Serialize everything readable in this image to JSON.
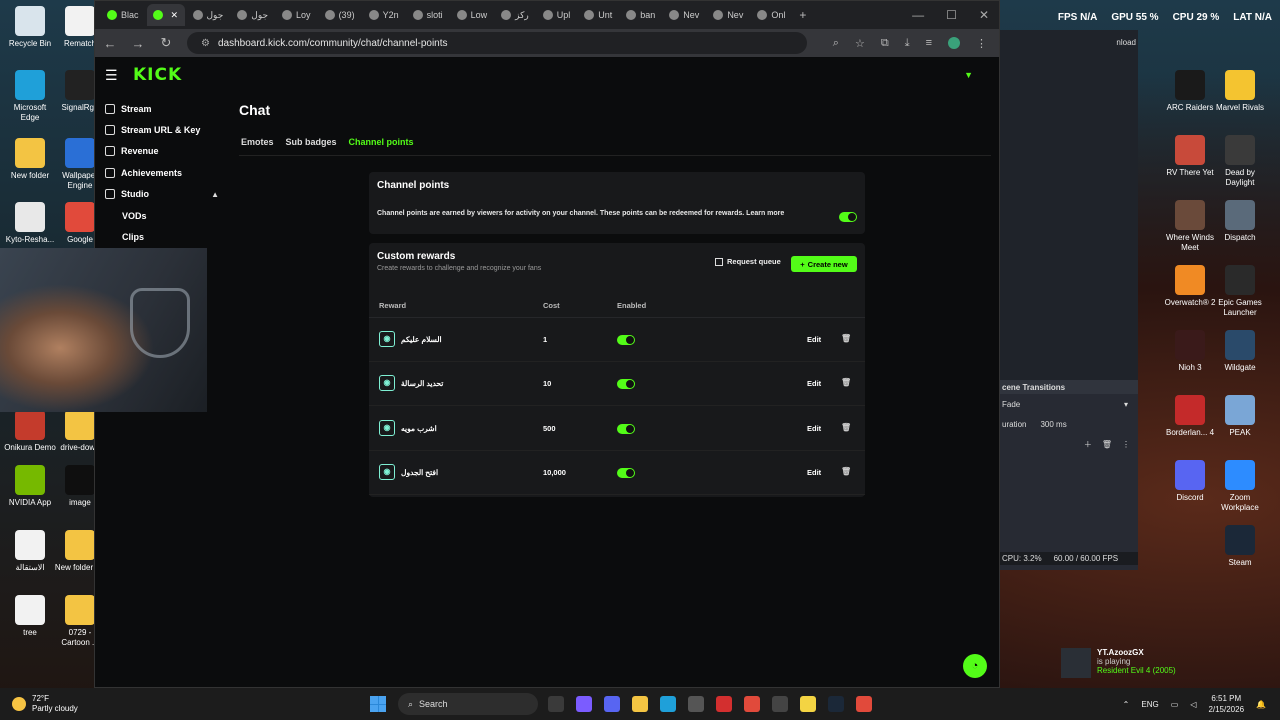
{
  "hud": {
    "fps_label": "FPS",
    "fps": "N/A",
    "gpu_label": "GPU",
    "gpu": "55 %",
    "cpu_label": "CPU",
    "cpu": "29 %",
    "lat_label": "LAT",
    "lat": "N/A"
  },
  "desktop_left": [
    {
      "label": "Recycle Bin",
      "color": "#d9e4ec"
    },
    {
      "label": "Rematch",
      "color": "#f2f2f2"
    },
    {
      "label": "Microsoft Edge",
      "color": "#1fa0d9"
    },
    {
      "label": "SignalRgb",
      "color": "#222222"
    },
    {
      "label": "New folder",
      "color": "#f3c443"
    },
    {
      "label": "Wallpaper Engine",
      "color": "#2a6fd6"
    },
    {
      "label": "Kyto-Resha...",
      "color": "#e8e8e8"
    },
    {
      "label": "Google",
      "color": "#e14a3b"
    },
    {
      "label": "Onikura Demo",
      "color": "#c43b2c"
    },
    {
      "label": "drive-down",
      "color": "#f3c443"
    },
    {
      "label": "NVIDIA App",
      "color": "#76b900"
    },
    {
      "label": "image",
      "color": "#0f0f0f"
    },
    {
      "label": "الاستقالة",
      "color": "#f2f2f2"
    },
    {
      "label": "New folder (3)",
      "color": "#f3c443"
    },
    {
      "label": "tree",
      "color": "#f2f2f2"
    },
    {
      "label": "0729 - Cartoon ...",
      "color": "#f3c443"
    }
  ],
  "desktop_right": [
    {
      "label": "ARC Raiders",
      "color": "#1a1a1a"
    },
    {
      "label": "Marvel Rivals",
      "color": "#f4c430"
    },
    {
      "label": "RV There Yet",
      "color": "#c84a3a"
    },
    {
      "label": "Dead by Daylight",
      "color": "#3a3a3a"
    },
    {
      "label": "Where Winds Meet",
      "color": "#6a4a3a"
    },
    {
      "label": "Dispatch",
      "color": "#5a6a7a"
    },
    {
      "label": "Overwatch® 2",
      "color": "#f08a24"
    },
    {
      "label": "Epic Games Launcher",
      "color": "#2a2a2a"
    },
    {
      "label": "Nioh 3",
      "color": "#3a1a1a"
    },
    {
      "label": "Wildgate",
      "color": "#2a4a6a"
    },
    {
      "label": "Borderlan... 4",
      "color": "#c42a2a"
    },
    {
      "label": "PEAK",
      "color": "#7aa6d6"
    },
    {
      "label": "Discord",
      "color": "#5865f2"
    },
    {
      "label": "Zoom Workplace",
      "color": "#2d8cff"
    },
    {
      "label": "Steam",
      "color": "#1b2838"
    }
  ],
  "browser": {
    "tabs": [
      "Blac",
      "",
      "جول",
      "جول",
      "Loy",
      "(39)",
      "Y2n",
      "sloti",
      "Low",
      "ركز",
      "Upl",
      "Unt",
      "ban",
      "Nev",
      "Nev",
      "Onl"
    ],
    "new_tab": "+",
    "url": "dashboard.kick.com/community/chat/channel-points"
  },
  "app": {
    "logo": "KICK",
    "sidebar": [
      {
        "label": "Stream"
      },
      {
        "label": "Stream URL & Key"
      },
      {
        "label": "Revenue"
      },
      {
        "label": "Achievements"
      },
      {
        "label": "Studio"
      }
    ],
    "studio_sub": [
      "VODs",
      "Clips"
    ],
    "page_title": "Chat",
    "tabs": [
      "Emotes",
      "Sub badges",
      "Channel points"
    ],
    "channel_points": {
      "title": "Channel points",
      "description": "Channel points are earned by viewers for activity on your channel. These points can be redeemed for rewards. Learn more",
      "enabled": true
    },
    "custom_rewards": {
      "title": "Custom rewards",
      "subtitle": "Create rewards to challenge and recognize your fans",
      "request_queue": "Request queue",
      "create_new": "Create new",
      "columns": {
        "reward": "Reward",
        "cost": "Cost",
        "enabled": "Enabled"
      },
      "edit_label": "Edit",
      "rows": [
        {
          "name": "السلام عليكم",
          "cost": "1"
        },
        {
          "name": "تحديد الرسالة",
          "cost": "10"
        },
        {
          "name": "اشرب مويه",
          "cost": "500"
        },
        {
          "name": "افتح الجدول",
          "cost": "10,000"
        }
      ]
    }
  },
  "obs": {
    "scene_transitions": "cene Transitions",
    "transition": "Fade",
    "duration_label": "uration",
    "duration": "300 ms",
    "cpu": "CPU: 3.2%",
    "fps": "60.00 / 60.00 FPS",
    "download": "nload"
  },
  "notification": {
    "user": "YT.AzoozGX",
    "status": "is playing",
    "game": "Resident Evil 4 (2005)"
  },
  "taskbar": {
    "temp": "72°F",
    "weather": "Partly cloudy",
    "search": "Search",
    "lang": "ENG",
    "time": "6:51 PM",
    "date": "2/15/2026"
  }
}
